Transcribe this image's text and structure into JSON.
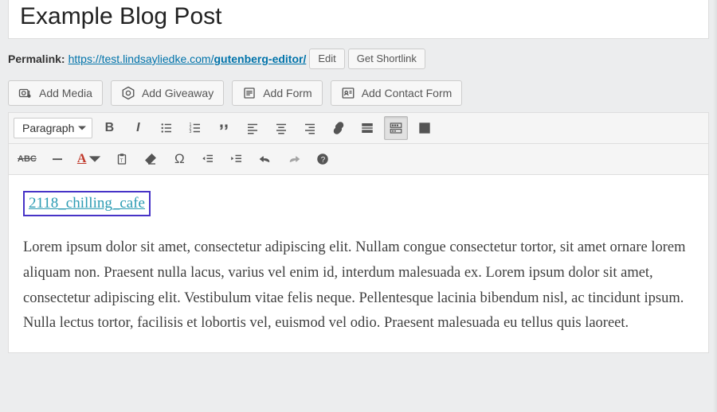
{
  "post": {
    "title": "Example Blog Post"
  },
  "permalink": {
    "label": "Permalink:",
    "base": "https://test.lindsayliedke.com/",
    "slug": "gutenberg-editor/",
    "edit": "Edit",
    "get_shortlink": "Get Shortlink"
  },
  "media_buttons": {
    "add_media": "Add Media",
    "add_giveaway": "Add Giveaway",
    "add_form": "Add Form",
    "add_contact_form": "Add Contact Form"
  },
  "toolbar": {
    "format": "Paragraph",
    "bold": "B",
    "italic": "I",
    "abc": "ABC",
    "A": "A",
    "omega": "Ω",
    "help": "?"
  },
  "content": {
    "shortcode_text": "2118_chilling_cafe",
    "paragraph": "Lorem ipsum dolor sit amet, consectetur adipiscing elit. Nullam congue consectetur tortor, sit amet ornare lorem aliquam non. Praesent nulla lacus, varius vel enim id, interdum malesuada ex. Lorem ipsum dolor sit amet, consectetur adipiscing elit. Vestibulum vitae felis neque. Pellentesque lacinia bibendum nisl, ac tincidunt ipsum. Nulla lectus tortor, facilisis et lobortis vel, euismod vel odio. Praesent malesuada eu tellus quis laoreet."
  }
}
